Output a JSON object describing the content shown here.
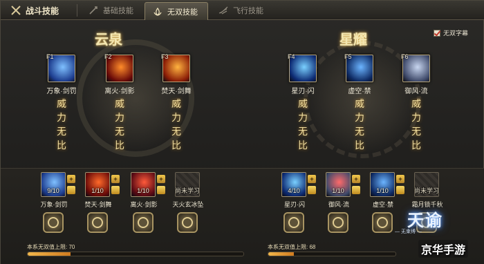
{
  "tabs": [
    {
      "label": "战斗技能",
      "active": false,
      "icon": "swords-icon"
    },
    {
      "label": "基础技能",
      "active": false,
      "icon": "sword-icon"
    },
    {
      "label": "无双技能",
      "active": true,
      "icon": "lotus-icon"
    },
    {
      "label": "飞行技能",
      "active": false,
      "icon": "wing-icon"
    }
  ],
  "subtitle_toggle": {
    "label": "无双字幕",
    "checked": true
  },
  "left_group": {
    "calligraphy": "云泉",
    "skills": [
      {
        "key": "F1",
        "name": "万象·剑罚",
        "color_a": "#1d3d8f",
        "color_b": "#7fc0ff"
      },
      {
        "key": "F2",
        "name": "离火·剑影",
        "color_a": "#6a0a08",
        "color_b": "#ff8c2a"
      },
      {
        "key": "F3",
        "name": "焚天·剑舞",
        "color_a": "#8a1c06",
        "color_b": "#ffb340"
      }
    ],
    "vertical_text": "威力无比"
  },
  "right_group": {
    "calligraphy": "星耀",
    "skills": [
      {
        "key": "F4",
        "name": "星刃·闪",
        "color_a": "#0d2b74",
        "color_b": "#7ad0ff"
      },
      {
        "key": "F5",
        "name": "虚空·禁",
        "color_a": "#0e2a63",
        "color_b": "#6bb4ff"
      },
      {
        "key": "F6",
        "name": "御风·流",
        "color_a": "#3f4a6a",
        "color_b": "#c8d6f0"
      }
    ],
    "vertical_text": "威力无比"
  },
  "left_slots": [
    {
      "name": "万象·剑罚",
      "level": "9/10",
      "locked": false,
      "color_a": "#1d3d8f",
      "color_b": "#7fc0ff"
    },
    {
      "name": "焚天·剑舞",
      "level": "1/10",
      "locked": false,
      "color_a": "#6a0a08",
      "color_b": "#ff6a2a"
    },
    {
      "name": "离火·剑影",
      "level": "1/10",
      "locked": false,
      "color_a": "#5a0a14",
      "color_b": "#ff5a3a"
    },
    {
      "name": "天火玄冰坠",
      "level": "尚未学习",
      "locked": true
    }
  ],
  "right_slots": [
    {
      "name": "星刃·闪",
      "level": "4/10",
      "locked": false,
      "color_a": "#0d2b74",
      "color_b": "#7ad0ff"
    },
    {
      "name": "御风·流",
      "level": "1/10",
      "locked": false,
      "color_a": "#3f4a6a",
      "color_b": "#ff6a6a"
    },
    {
      "name": "虚空·禁",
      "level": "1/10",
      "locked": false,
      "color_a": "#0e2a63",
      "color_b": "#6bb4ff"
    },
    {
      "name": "霜月锁千秋",
      "level": "尚未学习",
      "locked": true
    }
  ],
  "left_cap": {
    "label": "本系无双值上限: 70",
    "progress": 0.2
  },
  "right_cap": {
    "label": "本系无双值上限: 68",
    "progress": 0.2
  },
  "logo": {
    "title": "天谕",
    "subtitle": "— 无束缚 —",
    "watermark": "京华手游"
  }
}
